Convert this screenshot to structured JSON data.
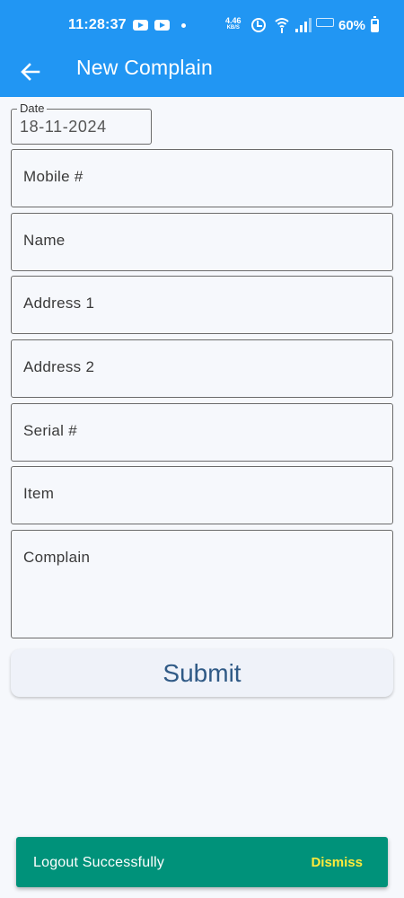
{
  "status_bar": {
    "time": "11:28:37",
    "net_speed": "4.46",
    "net_speed_unit": "KB/S",
    "battery_percent": "60%",
    "battery_level": 0.6,
    "icons": [
      "youtube-icon",
      "youtube-icon",
      "dot-icon",
      "alarm-icon",
      "wifi-icon",
      "signal-icon",
      "no-signal-icon",
      "battery-icon"
    ]
  },
  "app_bar": {
    "title": "New Complain",
    "back_icon": "arrow-left-icon"
  },
  "form": {
    "date_label": "Date",
    "date_value": "18-11-2024",
    "mobile_placeholder": "Mobile #",
    "name_placeholder": "Name",
    "address1_placeholder": "Address 1",
    "address2_placeholder": "Address 2",
    "serial_placeholder": "Serial #",
    "item_placeholder": "Item",
    "complain_placeholder": "Complain",
    "submit_label": "Submit"
  },
  "snackbar": {
    "message": "Logout Successfully",
    "action_label": "Dismiss"
  },
  "colors": {
    "primary": "#2196f3",
    "snackbar_bg": "#00927a",
    "snackbar_action": "#ffeb3b",
    "submit_text": "#305a86"
  }
}
